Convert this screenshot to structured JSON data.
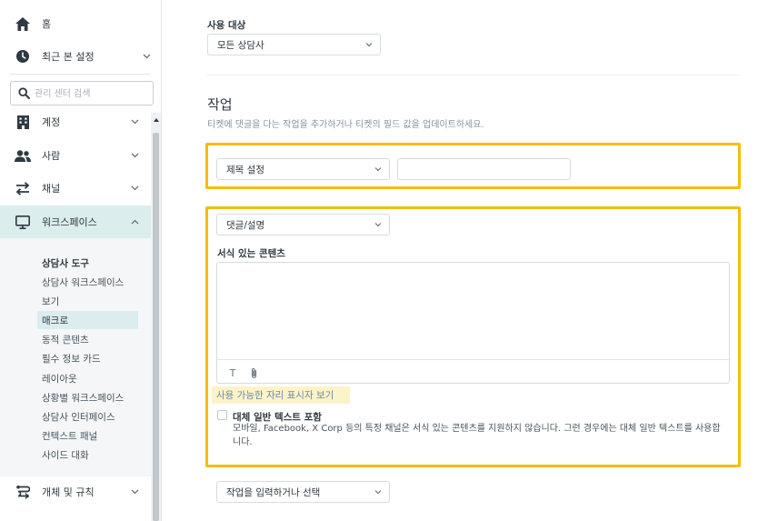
{
  "sidebar": {
    "items": [
      {
        "label": "홈",
        "icon": "home-icon"
      },
      {
        "label": "최근 본 설정",
        "icon": "clock-icon"
      },
      {
        "label": "계정",
        "icon": "building-icon"
      },
      {
        "label": "사람",
        "icon": "people-icon"
      },
      {
        "label": "채널",
        "icon": "arrows-icon"
      },
      {
        "label": "워크스페이스",
        "icon": "monitor-icon"
      },
      {
        "label": "개체 및 규칙",
        "icon": "objects-rules-icon"
      }
    ],
    "search_placeholder": "관리 센터 검색",
    "workspace_sub": [
      "상담사 도구",
      "상담사 워크스페이스",
      "보기",
      "매크로",
      "동적 콘텐츠",
      "필수 정보 카드",
      "레이아웃",
      "상황별 워크스페이스",
      "상담사 인터페이스",
      "컨텍스트 패널",
      "사이드 대화"
    ],
    "selected_sub": "매크로"
  },
  "main": {
    "audience_label": "사용 대상",
    "audience_value": "모든 상담사",
    "actions_title": "작업",
    "actions_desc": "티켓에 댓글을 다는 작업을 추가하거나 티켓의 필드 값을 업데이트하세요.",
    "action1_select": "제목 설정",
    "action1_value": "",
    "action2_select": "댓글/설명",
    "rich_content_label": "서식 있는 콘텐츠",
    "toolbar_text_glyph": "T",
    "placeholder_link": "사용 가능한 자리 표시자 보기",
    "fallback_label": "대체 일반 텍스트 포함",
    "fallback_desc": "모바일, Facebook, X Corp 등의 특정 채널은 서식 있는 콘텐츠를 지원하지 않습니다. 그런 경우에는 대체 일반 텍스트를 사용합니다.",
    "action3_select": "작업을 입력하거나 선택"
  },
  "colors": {
    "highlight": "#f5bd0a",
    "active_bg": "#dcedee",
    "placeholder_bg": "#fcf3c9"
  }
}
